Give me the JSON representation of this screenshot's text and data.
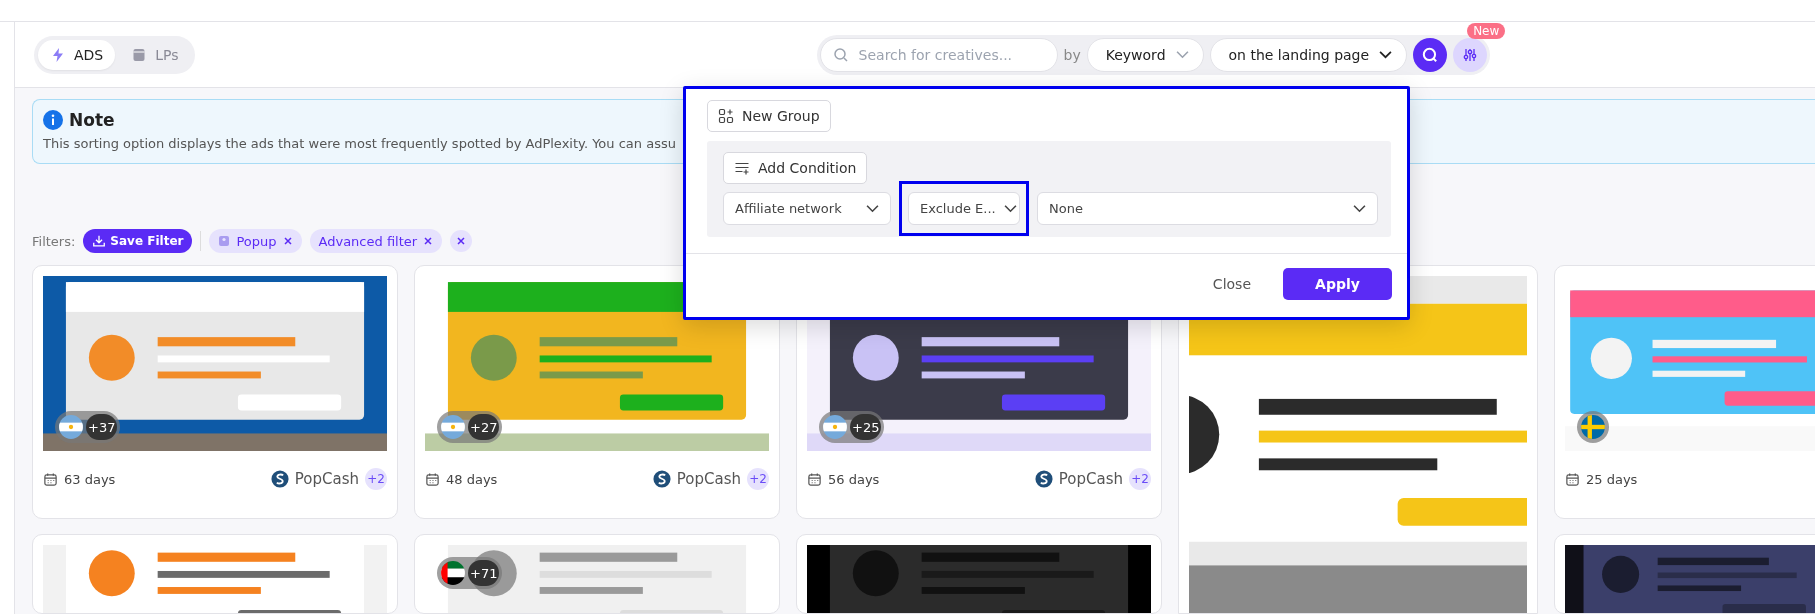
{
  "mode_tabs": [
    {
      "label": "ADS",
      "kind": "ads",
      "selected": true
    },
    {
      "label": "LPs",
      "kind": "lps",
      "selected": false
    }
  ],
  "search": {
    "placeholder": "Search for creatives...",
    "by_label": "by",
    "by_select": "Keyword",
    "scope_select": "on the landing page",
    "new_badge": "New"
  },
  "note": {
    "title": "Note",
    "text": "This sorting option displays the ads that were most frequently spotted by AdPlexity. You can assu"
  },
  "filters": {
    "label": "Filters:",
    "save_button": "Save Filter",
    "chips": [
      {
        "label": "Popup",
        "kind": "type"
      },
      {
        "label": "Advanced filter",
        "kind": "plain"
      }
    ]
  },
  "popup": {
    "new_group": "New Group",
    "add_condition": "Add Condition",
    "field_select": "Affiliate network",
    "operator_select": "Exclude E...",
    "value_select": "None",
    "close_button": "Close",
    "apply_button": "Apply"
  },
  "cards": [
    {
      "kind": "ad",
      "flag": {
        "kind": "argentina"
      },
      "count": "+37",
      "days": "63 days",
      "network": "PopCash",
      "extra": "+2"
    },
    {
      "kind": "ad",
      "flag": {
        "kind": "argentina"
      },
      "count": "+27",
      "days": "48 days",
      "network": "PopCash",
      "extra": "+2"
    },
    {
      "kind": "ad",
      "flag": {
        "kind": "argentina"
      },
      "count": "+25",
      "days": "56 days",
      "network": "PopCash",
      "extra": "+2"
    },
    {
      "kind": "lp"
    },
    {
      "kind": "ad",
      "flag": {
        "kind": "sweden"
      },
      "days": "25 days"
    },
    {
      "kind": "ad"
    },
    {
      "kind": "ad",
      "flag": {
        "kind": "uae"
      },
      "count": "+71"
    },
    {
      "kind": "ad"
    },
    {
      "kind": "ad"
    }
  ]
}
